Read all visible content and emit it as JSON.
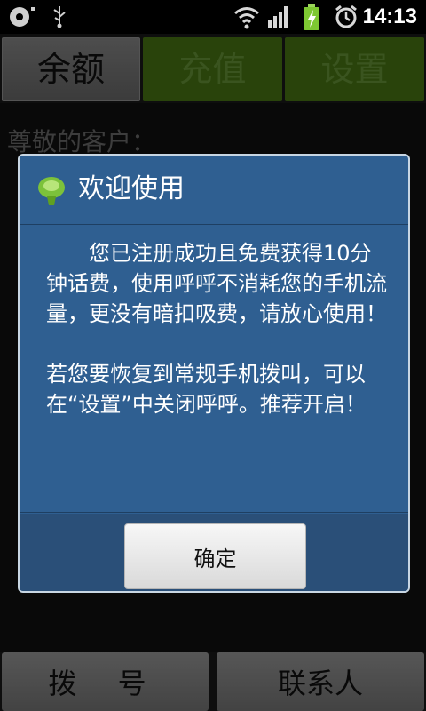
{
  "status_bar": {
    "time": "14:13",
    "icons": [
      "cd-icon",
      "usb-icon",
      "wifi-icon",
      "signal-icon",
      "battery-charging-icon",
      "alarm-icon"
    ]
  },
  "tabs": [
    {
      "label": "余额",
      "selected": true
    },
    {
      "label": "充值",
      "selected": false
    },
    {
      "label": "设置",
      "selected": false
    }
  ],
  "content": {
    "greeting": "尊敬的客户："
  },
  "bottom_bar": {
    "dial_label": "拨 号",
    "contacts_label": "联系人"
  },
  "dialog": {
    "icon": "app-logo-icon",
    "title": "欢迎使用",
    "message": "　　您已注册成功且免费获得10分钟话费，使用呼呼不消耗您的手机流量，更没有暗扣吸费，请放心使用！\n\n若您要恢复到常规手机拨叫，可以在“设置”中关闭呼呼。推荐开启！",
    "ok_label": "确定"
  },
  "colors": {
    "dialog_bg": "#2f5f91",
    "tab_active_bg": "#4c7a15",
    "status_bar_bg": "#000000",
    "battery_green": "#7ec832"
  }
}
